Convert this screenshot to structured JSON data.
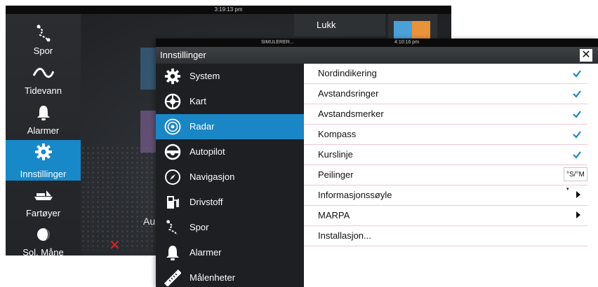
{
  "background": {
    "status_time": "3:19:13 pm",
    "close_label": "Lukk",
    "partial_text": "Au",
    "sidebar": [
      {
        "label": "Spor",
        "icon": "track-icon"
      },
      {
        "label": "Tidevann",
        "icon": "tide-icon"
      },
      {
        "label": "Alarmer",
        "icon": "bell-icon"
      },
      {
        "label": "Innstillinger",
        "icon": "gear-icon",
        "active": true
      },
      {
        "label": "Fartøyer",
        "icon": "vessels-icon"
      },
      {
        "label": "Sol, Måne",
        "icon": "sun-moon-icon"
      }
    ]
  },
  "dialog": {
    "status_mode": "SIMULERER...",
    "status_time": "4:10:16 pm",
    "title": "Innstillinger",
    "menu": [
      {
        "label": "System",
        "icon": "gear-icon"
      },
      {
        "label": "Kart",
        "icon": "chart-icon"
      },
      {
        "label": "Radar",
        "icon": "radar-icon",
        "active": true
      },
      {
        "label": "Autopilot",
        "icon": "helm-icon"
      },
      {
        "label": "Navigasjon",
        "icon": "compass-icon"
      },
      {
        "label": "Drivstoff",
        "icon": "fuel-icon"
      },
      {
        "label": "Spor",
        "icon": "track-icon"
      },
      {
        "label": "Alarmer",
        "icon": "bell-icon"
      },
      {
        "label": "Målenheter",
        "icon": "ruler-icon"
      }
    ],
    "settings": [
      {
        "label": "Nordindikering",
        "type": "checkbox",
        "checked": true
      },
      {
        "label": "Avstandsringer",
        "type": "checkbox",
        "checked": true
      },
      {
        "label": "Avstandsmerker",
        "type": "checkbox",
        "checked": true
      },
      {
        "label": "Kompass",
        "type": "checkbox",
        "checked": true
      },
      {
        "label": "Kurslinje",
        "type": "checkbox",
        "checked": true
      },
      {
        "label": "Peilinger",
        "type": "select",
        "value": "°S/°M"
      },
      {
        "label": "Informasjonssøyle",
        "type": "submenu"
      },
      {
        "label": "MARPA",
        "type": "submenu"
      },
      {
        "label": "Installasjon...",
        "type": "action"
      }
    ]
  },
  "colors": {
    "accent": "#1a86c6",
    "menu_bg": "#1d1f22",
    "row_divider": "#f0c8d3",
    "check": "#1a86c6"
  }
}
